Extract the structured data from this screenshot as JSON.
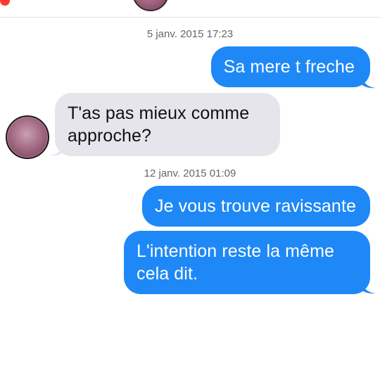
{
  "conversation": {
    "messages": [
      {
        "direction": "date",
        "text": "5 janv. 2015 17:23"
      },
      {
        "direction": "out",
        "text": "Sa mere t freche"
      },
      {
        "direction": "in",
        "text": "T'as pas mieux comme approche?"
      },
      {
        "direction": "date",
        "text": "12 janv. 2015 01:09"
      },
      {
        "direction": "out",
        "text": "Je vous trouve ravissante"
      },
      {
        "direction": "out",
        "text": "L'intention reste la même cela dit."
      }
    ]
  },
  "colors": {
    "outgoing_bubble": "#1e88f7",
    "incoming_bubble": "#e6e5eb",
    "timestamp_text": "#666666",
    "back_indicator": "#ff3b30"
  },
  "icons": {
    "contact_avatar": "avatar",
    "header_avatar": "avatar"
  }
}
